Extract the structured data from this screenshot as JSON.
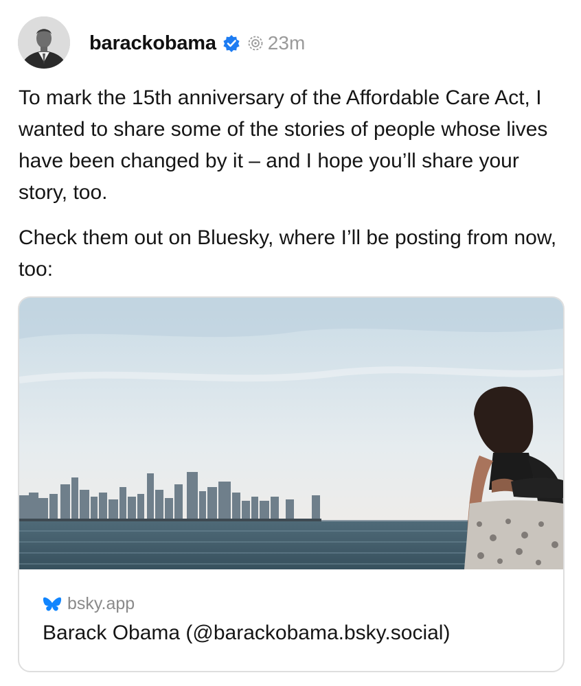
{
  "post": {
    "author": {
      "username": "barackobama",
      "verified": true,
      "avatar_icon": "profile-photo"
    },
    "timestamp": "23m",
    "paragraphs": [
      "To mark the 15th anniversary of the Affordable Care Act, I wanted to share some of the stories of people whose lives have been changed by it – and I hope you’ll share your story, too.",
      "Check them out on Bluesky, where I’ll be posting from now, too:"
    ],
    "link_card": {
      "domain": "bsky.app",
      "title": "Barack Obama (@barackobama.bsky.social)",
      "domain_icon": "butterfly-icon"
    }
  },
  "colors": {
    "verified_badge": "#1d7cf2",
    "bluesky_blue": "#1185fe",
    "secondary_text": "#9a9a9a"
  }
}
